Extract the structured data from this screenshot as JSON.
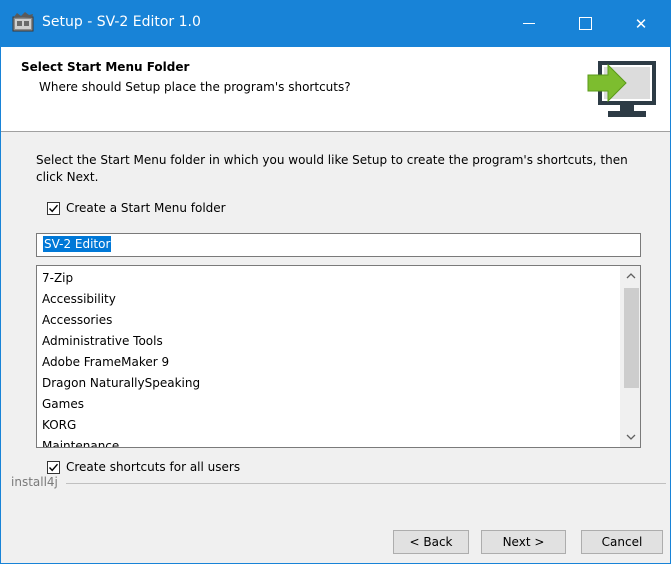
{
  "window": {
    "title": "Setup - SV-2 Editor 1.0",
    "accent_color": "#1883d7"
  },
  "titlebar": {
    "app_icon": "installer-icon",
    "minimize_icon": "minimize-icon",
    "maximize_icon": "maximize-icon",
    "close_icon": "close-icon",
    "close_glyph": "✕"
  },
  "header": {
    "title": "Select Start Menu Folder",
    "subtitle": "Where should Setup place the program's shortcuts?",
    "graphic": "computer-install-arrow-icon"
  },
  "main": {
    "instructions": "Select the Start Menu folder in which you would like Setup to create the program's shortcuts, then click Next.",
    "create_folder_label": "Create a Start Menu folder",
    "create_folder_checked": true,
    "folder_name": "SV-2 Editor",
    "folder_list": [
      "7-Zip",
      "Accessibility",
      "Accessories",
      "Administrative Tools",
      "Adobe FrameMaker 9",
      "Dragon NaturallySpeaking",
      "Games",
      "KORG",
      "Maintenance"
    ],
    "scroll_up_glyph": "⌃",
    "scroll_down_glyph": "⌄",
    "all_users_label": "Create shortcuts for all users",
    "all_users_checked": true
  },
  "footer": {
    "brand": "install4j",
    "back_label": "< Back",
    "next_label": "Next >",
    "cancel_label": "Cancel"
  }
}
